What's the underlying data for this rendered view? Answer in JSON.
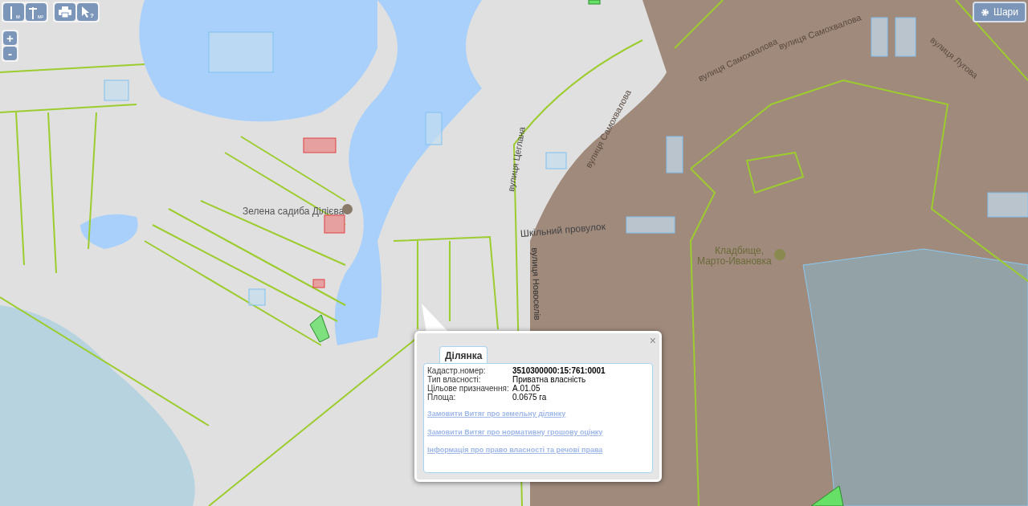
{
  "toolbar": {
    "measure_tools": [
      {
        "kind": "length",
        "unit": "м"
      },
      {
        "kind": "area",
        "unit": "м²"
      }
    ],
    "tools": [
      {
        "kind": "print"
      },
      {
        "kind": "identify",
        "mark": "?"
      }
    ]
  },
  "zoom": {
    "in": "+",
    "out": "-"
  },
  "layers_button": {
    "label": "Шари"
  },
  "map_labels": [
    {
      "text": "Зелена садиба Ділієва"
    },
    {
      "text": "Шкільний провулок"
    },
    {
      "text": "Кладбище,"
    },
    {
      "text": "Марто-Ивановка"
    },
    {
      "text": "вулиця Самохвалова"
    },
    {
      "text": "вулиця Самохвалова"
    },
    {
      "text": "вулиця Самохвалова"
    },
    {
      "text": "вулиця Новоселів"
    },
    {
      "text": "вулиця Цеглана"
    },
    {
      "text": "вулиця Лугова"
    }
  ],
  "popup": {
    "close": "×",
    "tabs": [
      {
        "label": "Ділянка",
        "selected": true
      }
    ],
    "fields": [
      {
        "label": "Кадастр.номер:",
        "value": "3510300000:15:761:0001",
        "bold": true
      },
      {
        "label": "Тип власності:",
        "value": "Приватна власність",
        "bold": false
      },
      {
        "label": "Цільове призначення:",
        "value": "А.01.05",
        "bold": false
      },
      {
        "label": "Площа:",
        "value": "0.0675 га",
        "bold": false
      }
    ],
    "links": [
      "Замовити Витяг про земельну ділянку",
      "Замовити Витяг про нормативну грошову оцінку",
      "Інформація про право власності та речові права"
    ]
  }
}
